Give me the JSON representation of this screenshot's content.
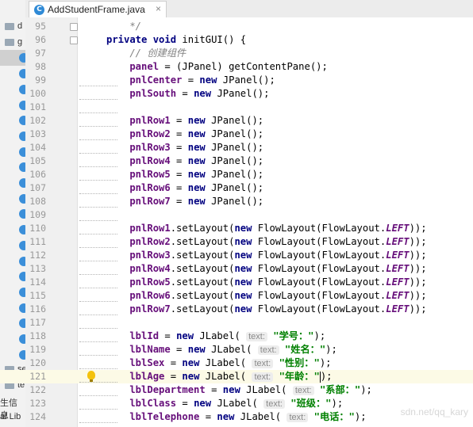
{
  "tab": {
    "icon_letter": "C",
    "title": "AddStudentFrame.java",
    "close": "×"
  },
  "left_panel": [
    {
      "kind": "folder",
      "text": "d"
    },
    {
      "kind": "folder",
      "text": "g"
    },
    {
      "kind": "class",
      "text": ""
    },
    {
      "kind": "class",
      "text": ""
    },
    {
      "kind": "class",
      "text": ""
    },
    {
      "kind": "class",
      "text": ""
    },
    {
      "kind": "class",
      "text": ""
    },
    {
      "kind": "class",
      "text": ""
    },
    {
      "kind": "class",
      "text": ""
    },
    {
      "kind": "class",
      "text": ""
    },
    {
      "kind": "class",
      "text": ""
    },
    {
      "kind": "class",
      "text": ""
    },
    {
      "kind": "class",
      "text": ""
    },
    {
      "kind": "class",
      "text": ""
    },
    {
      "kind": "class",
      "text": ""
    },
    {
      "kind": "class",
      "text": ""
    },
    {
      "kind": "class",
      "text": ""
    },
    {
      "kind": "class",
      "text": ""
    },
    {
      "kind": "class",
      "text": ""
    },
    {
      "kind": "class",
      "text": ""
    },
    {
      "kind": "class",
      "text": ""
    },
    {
      "kind": "class",
      "text": ""
    },
    {
      "kind": "folder",
      "text": "se"
    },
    {
      "kind": "folder",
      "text": "te"
    },
    {
      "kind": "text",
      "text": "生信息"
    },
    {
      "kind": "text",
      "text": "al Lib"
    }
  ],
  "code_lines": [
    {
      "n": "95",
      "segs": [
        {
          "c": "comment",
          "t": "    */"
        }
      ]
    },
    {
      "n": "96",
      "segs": [
        {
          "c": "kw",
          "t": "private void "
        },
        {
          "c": "",
          "t": "initGUI() {"
        }
      ]
    },
    {
      "n": "97",
      "segs": [
        {
          "c": "comment",
          "t": "    // 创建组件"
        }
      ]
    },
    {
      "n": "98",
      "segs": [
        {
          "c": "field",
          "t": "    panel"
        },
        {
          "c": "",
          "t": " = (JPanel) getContentPane();"
        }
      ]
    },
    {
      "n": "99",
      "segs": [
        {
          "c": "field",
          "t": "    pnlCenter"
        },
        {
          "c": "",
          "t": " = "
        },
        {
          "c": "kw",
          "t": "new "
        },
        {
          "c": "",
          "t": "JPanel();"
        }
      ]
    },
    {
      "n": "100",
      "segs": [
        {
          "c": "field",
          "t": "    pnlSouth"
        },
        {
          "c": "",
          "t": " = "
        },
        {
          "c": "kw",
          "t": "new "
        },
        {
          "c": "",
          "t": "JPanel();"
        }
      ]
    },
    {
      "n": "101",
      "segs": []
    },
    {
      "n": "102",
      "segs": [
        {
          "c": "field",
          "t": "    pnlRow1"
        },
        {
          "c": "",
          "t": " = "
        },
        {
          "c": "kw",
          "t": "new "
        },
        {
          "c": "",
          "t": "JPanel();"
        }
      ]
    },
    {
      "n": "103",
      "segs": [
        {
          "c": "field",
          "t": "    pnlRow2"
        },
        {
          "c": "",
          "t": " = "
        },
        {
          "c": "kw",
          "t": "new "
        },
        {
          "c": "",
          "t": "JPanel();"
        }
      ]
    },
    {
      "n": "104",
      "segs": [
        {
          "c": "field",
          "t": "    pnlRow3"
        },
        {
          "c": "",
          "t": " = "
        },
        {
          "c": "kw",
          "t": "new "
        },
        {
          "c": "",
          "t": "JPanel();"
        }
      ]
    },
    {
      "n": "105",
      "segs": [
        {
          "c": "field",
          "t": "    pnlRow4"
        },
        {
          "c": "",
          "t": " = "
        },
        {
          "c": "kw",
          "t": "new "
        },
        {
          "c": "",
          "t": "JPanel();"
        }
      ]
    },
    {
      "n": "106",
      "segs": [
        {
          "c": "field",
          "t": "    pnlRow5"
        },
        {
          "c": "",
          "t": " = "
        },
        {
          "c": "kw",
          "t": "new "
        },
        {
          "c": "",
          "t": "JPanel();"
        }
      ]
    },
    {
      "n": "107",
      "segs": [
        {
          "c": "field",
          "t": "    pnlRow6"
        },
        {
          "c": "",
          "t": " = "
        },
        {
          "c": "kw",
          "t": "new "
        },
        {
          "c": "",
          "t": "JPanel();"
        }
      ]
    },
    {
      "n": "108",
      "segs": [
        {
          "c": "field",
          "t": "    pnlRow7"
        },
        {
          "c": "",
          "t": " = "
        },
        {
          "c": "kw",
          "t": "new "
        },
        {
          "c": "",
          "t": "JPanel();"
        }
      ]
    },
    {
      "n": "109",
      "segs": []
    },
    {
      "n": "110",
      "segs": [
        {
          "c": "field",
          "t": "    pnlRow1"
        },
        {
          "c": "",
          "t": ".setLayout("
        },
        {
          "c": "kw",
          "t": "new "
        },
        {
          "c": "",
          "t": "FlowLayout(FlowLayout."
        },
        {
          "c": "it",
          "t": "LEFT"
        },
        {
          "c": "",
          "t": "));"
        }
      ]
    },
    {
      "n": "111",
      "segs": [
        {
          "c": "field",
          "t": "    pnlRow2"
        },
        {
          "c": "",
          "t": ".setLayout("
        },
        {
          "c": "kw",
          "t": "new "
        },
        {
          "c": "",
          "t": "FlowLayout(FlowLayout."
        },
        {
          "c": "it",
          "t": "LEFT"
        },
        {
          "c": "",
          "t": "));"
        }
      ]
    },
    {
      "n": "112",
      "segs": [
        {
          "c": "field",
          "t": "    pnlRow3"
        },
        {
          "c": "",
          "t": ".setLayout("
        },
        {
          "c": "kw",
          "t": "new "
        },
        {
          "c": "",
          "t": "FlowLayout(FlowLayout."
        },
        {
          "c": "it",
          "t": "LEFT"
        },
        {
          "c": "",
          "t": "));"
        }
      ]
    },
    {
      "n": "113",
      "segs": [
        {
          "c": "field",
          "t": "    pnlRow4"
        },
        {
          "c": "",
          "t": ".setLayout("
        },
        {
          "c": "kw",
          "t": "new "
        },
        {
          "c": "",
          "t": "FlowLayout(FlowLayout."
        },
        {
          "c": "it",
          "t": "LEFT"
        },
        {
          "c": "",
          "t": "));"
        }
      ]
    },
    {
      "n": "114",
      "segs": [
        {
          "c": "field",
          "t": "    pnlRow5"
        },
        {
          "c": "",
          "t": ".setLayout("
        },
        {
          "c": "kw",
          "t": "new "
        },
        {
          "c": "",
          "t": "FlowLayout(FlowLayout."
        },
        {
          "c": "it",
          "t": "LEFT"
        },
        {
          "c": "",
          "t": "));"
        }
      ]
    },
    {
      "n": "115",
      "segs": [
        {
          "c": "field",
          "t": "    pnlRow6"
        },
        {
          "c": "",
          "t": ".setLayout("
        },
        {
          "c": "kw",
          "t": "new "
        },
        {
          "c": "",
          "t": "FlowLayout(FlowLayout."
        },
        {
          "c": "it",
          "t": "LEFT"
        },
        {
          "c": "",
          "t": "));"
        }
      ]
    },
    {
      "n": "116",
      "segs": [
        {
          "c": "field",
          "t": "    pnlRow7"
        },
        {
          "c": "",
          "t": ".setLayout("
        },
        {
          "c": "kw",
          "t": "new "
        },
        {
          "c": "",
          "t": "FlowLayout(FlowLayout."
        },
        {
          "c": "it",
          "t": "LEFT"
        },
        {
          "c": "",
          "t": "));"
        }
      ]
    },
    {
      "n": "117",
      "segs": []
    },
    {
      "n": "118",
      "segs": [
        {
          "c": "field",
          "t": "    lblId"
        },
        {
          "c": "",
          "t": " = "
        },
        {
          "c": "kw",
          "t": "new "
        },
        {
          "c": "",
          "t": "JLabel( "
        },
        {
          "c": "hint",
          "t": "text:"
        },
        {
          "c": "str",
          "t": " \"学号：\""
        },
        {
          "c": "",
          "t": ");"
        }
      ]
    },
    {
      "n": "119",
      "segs": [
        {
          "c": "field",
          "t": "    lblName"
        },
        {
          "c": "",
          "t": " = "
        },
        {
          "c": "kw",
          "t": "new "
        },
        {
          "c": "",
          "t": "JLabel( "
        },
        {
          "c": "hint",
          "t": "text:"
        },
        {
          "c": "str",
          "t": " \"姓名：\""
        },
        {
          "c": "",
          "t": ");"
        }
      ]
    },
    {
      "n": "120",
      "segs": [
        {
          "c": "field",
          "t": "    lblSex"
        },
        {
          "c": "",
          "t": " = "
        },
        {
          "c": "kw",
          "t": "new "
        },
        {
          "c": "",
          "t": "JLabel( "
        },
        {
          "c": "hint",
          "t": "text:"
        },
        {
          "c": "str",
          "t": " \"性别：\""
        },
        {
          "c": "",
          "t": ");"
        }
      ]
    },
    {
      "n": "121",
      "segs": [
        {
          "c": "field",
          "t": "    lblAge"
        },
        {
          "c": "",
          "t": " = "
        },
        {
          "c": "kw",
          "t": "new "
        },
        {
          "c": "",
          "t": "JLabel( "
        },
        {
          "c": "hint",
          "t": "text:"
        },
        {
          "c": "str",
          "t": " \"年龄：\""
        },
        {
          "c": "",
          "t": ");"
        }
      ],
      "current": true
    },
    {
      "n": "122",
      "segs": [
        {
          "c": "field",
          "t": "    lblDepartment"
        },
        {
          "c": "",
          "t": " = "
        },
        {
          "c": "kw",
          "t": "new "
        },
        {
          "c": "",
          "t": "JLabel( "
        },
        {
          "c": "hint",
          "t": "text:"
        },
        {
          "c": "str",
          "t": " \"系部：\""
        },
        {
          "c": "",
          "t": ");"
        }
      ]
    },
    {
      "n": "123",
      "segs": [
        {
          "c": "field",
          "t": "    lblClass"
        },
        {
          "c": "",
          "t": " = "
        },
        {
          "c": "kw",
          "t": "new "
        },
        {
          "c": "",
          "t": "JLabel( "
        },
        {
          "c": "hint",
          "t": "text:"
        },
        {
          "c": "str",
          "t": " \"班级：\""
        },
        {
          "c": "",
          "t": ");"
        }
      ]
    },
    {
      "n": "124",
      "segs": [
        {
          "c": "field",
          "t": "    lblTelephone"
        },
        {
          "c": "",
          "t": " = "
        },
        {
          "c": "kw",
          "t": "new "
        },
        {
          "c": "",
          "t": "JLabel( "
        },
        {
          "c": "hint",
          "t": "text:"
        },
        {
          "c": "str",
          "t": " \"电话：\""
        },
        {
          "c": "",
          "t": ");"
        }
      ]
    }
  ],
  "watermark": "sdn.net/qq_kary"
}
